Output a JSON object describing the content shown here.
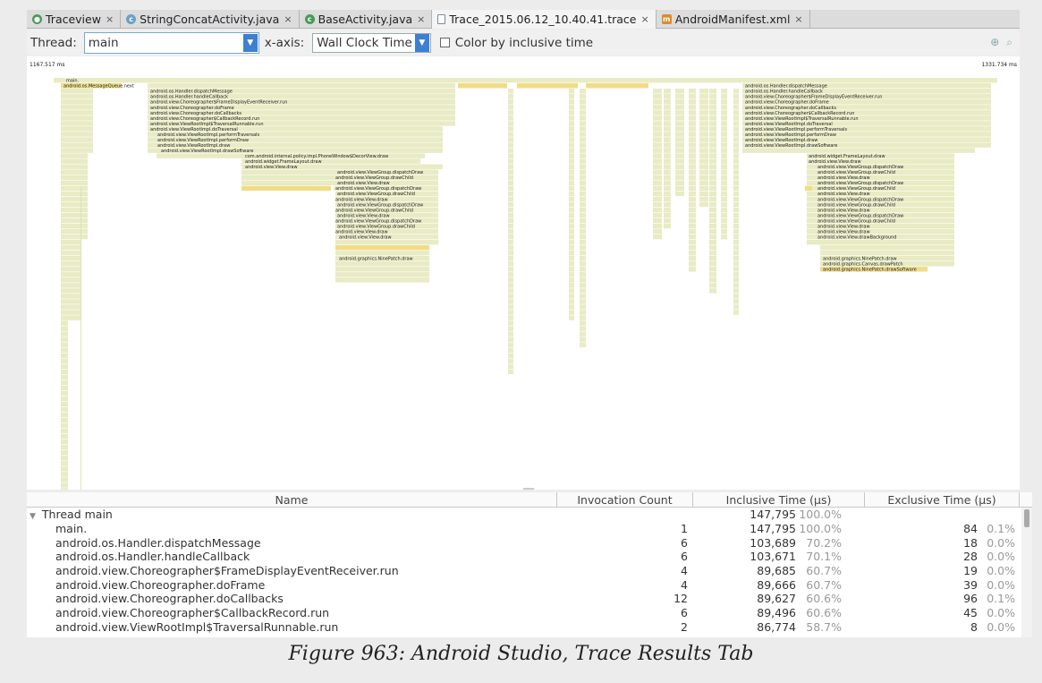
{
  "tabs": [
    {
      "label": "Traceview",
      "icon": "green-circle-icon"
    },
    {
      "label": "StringConcatActivity.java",
      "icon": "class-icon"
    },
    {
      "label": "BaseActivity.java",
      "icon": "class-icon"
    },
    {
      "label": "Trace_2015.06.12_10.40.41.trace",
      "icon": "document-icon",
      "active": true
    },
    {
      "label": "AndroidManifest.xml",
      "icon": "xml-icon"
    }
  ],
  "toolbar": {
    "thread_label": "Thread:",
    "thread_value": "main",
    "xaxis_label": "x-axis:",
    "xaxis_value": "Wall Clock Time",
    "color_label": "Color by inclusive time"
  },
  "timeline": {
    "start_time": "1167.517 ms",
    "end_time": "1331.734 ms",
    "colors": {
      "bar": "#e8ebc4",
      "highlight": "#f1dc86"
    },
    "labels_left": [
      "main.",
      "android.os.MessageQueue.next",
      "android.os.Handler.dispatchMessage",
      "android.os.Handler.handleCallback",
      "android.view.Choreographer$FrameDisplayEventReceiver.run",
      "android.view.Choreographer.doFrame",
      "android.view.Choreographer.doCallbacks",
      "android.view.Choreographer$CallbackRecord.run",
      "android.view.ViewRootImpl$TraversalRunnable.run",
      "android.view.ViewRootImpl.doTraversal",
      "android.view.ViewRootImpl.performTraversals",
      "android.view.ViewRootImpl.performDraw",
      "android.view.ViewRootImpl.draw",
      "android.view.ViewRootImpl.drawSoftware",
      "com.android.internal.policy.impl.PhoneWindow$DecorView.draw",
      "android.widget.FrameLayout.draw",
      "android.view.View.draw",
      "android.view.ViewGroup.dispatchDraw",
      "android.view.ViewGroup.drawChild",
      "android.view.View.draw",
      "android.view.ViewGroup.dispatchDraw",
      "android.view.ViewGroup.drawChild",
      "android.view.View.draw",
      "android.view.ViewGroup.dispatchDraw",
      "android.view.ViewGroup.drawChild",
      "android.view.View.draw",
      "android.view.ViewGroup.dispatchDraw",
      "android.view.ViewGroup.drawChild",
      "android.view.View.draw",
      "android.view.View.draw",
      "android.graphics.NinePatch.draw"
    ],
    "labels_right": [
      "android.os.Handler.dispatchMessage",
      "android.os.Handler.handleCallback",
      "android.view.Choreographer$FrameDisplayEventReceiver.run",
      "android.view.Choreographer.doFrame",
      "android.view.Choreographer.doCallbacks",
      "android.view.Choreographer$CallbackRecord.run",
      "android.view.ViewRootImpl$TraversalRunnable.run",
      "android.view.ViewRootImpl.doTraversal",
      "android.view.ViewRootImpl.performTraversals",
      "android.view.ViewRootImpl.performDraw",
      "android.view.ViewRootImpl.draw",
      "android.view.ViewRootImpl.drawSoftware",
      "android.widget.FrameLayout.draw",
      "android.view.View.draw",
      "android.view.ViewGroup.dispatchDraw",
      "android.view.ViewGroup.drawChild",
      "android.view.View.draw",
      "android.view.ViewGroup.dispatchDraw",
      "android.view.ViewGroup.drawChild",
      "android.view.View.draw",
      "android.view.ViewGroup.dispatchDraw",
      "android.view.ViewGroup.drawChild",
      "android.view.View.draw",
      "android.view.ViewGroup.dispatchDraw",
      "android.view.ViewGroup.drawChild",
      "android.view.View.draw",
      "android.view.View.draw",
      "android.view.View.drawBackground",
      "android.graphics.NinePatch.draw",
      "android.graphics.Canvas.drawPatch",
      "android.graphics.NinePatch.drawSoftware"
    ]
  },
  "table": {
    "headers": {
      "name": "Name",
      "invocation": "Invocation Count",
      "inclusive": "Inclusive Time (µs)",
      "exclusive": "Exclusive Time (µs)"
    },
    "group": {
      "name": "Thread main",
      "inclusive": "147,795",
      "inclusive_pct": "100.0%"
    },
    "rows": [
      {
        "name": "main.",
        "count": "1",
        "inc": "147,795",
        "inc_pct": "100.0%",
        "exc": "84",
        "exc_pct": "0.1%"
      },
      {
        "name": "android.os.Handler.dispatchMessage",
        "count": "6",
        "inc": "103,689",
        "inc_pct": "70.2%",
        "exc": "18",
        "exc_pct": "0.0%"
      },
      {
        "name": "android.os.Handler.handleCallback",
        "count": "6",
        "inc": "103,671",
        "inc_pct": "70.1%",
        "exc": "28",
        "exc_pct": "0.0%"
      },
      {
        "name": "android.view.Choreographer$FrameDisplayEventReceiver.run",
        "count": "4",
        "inc": "89,685",
        "inc_pct": "60.7%",
        "exc": "19",
        "exc_pct": "0.0%"
      },
      {
        "name": "android.view.Choreographer.doFrame",
        "count": "4",
        "inc": "89,666",
        "inc_pct": "60.7%",
        "exc": "39",
        "exc_pct": "0.0%"
      },
      {
        "name": "android.view.Choreographer.doCallbacks",
        "count": "12",
        "inc": "89,627",
        "inc_pct": "60.6%",
        "exc": "96",
        "exc_pct": "0.1%"
      },
      {
        "name": "android.view.Choreographer$CallbackRecord.run",
        "count": "6",
        "inc": "89,496",
        "inc_pct": "60.6%",
        "exc": "45",
        "exc_pct": "0.0%"
      },
      {
        "name": "android.view.ViewRootImpl$TraversalRunnable.run",
        "count": "2",
        "inc": "86,774",
        "inc_pct": "58.7%",
        "exc": "8",
        "exc_pct": "0.0%"
      }
    ]
  },
  "caption": "Figure 963: Android Studio, Trace Results Tab"
}
